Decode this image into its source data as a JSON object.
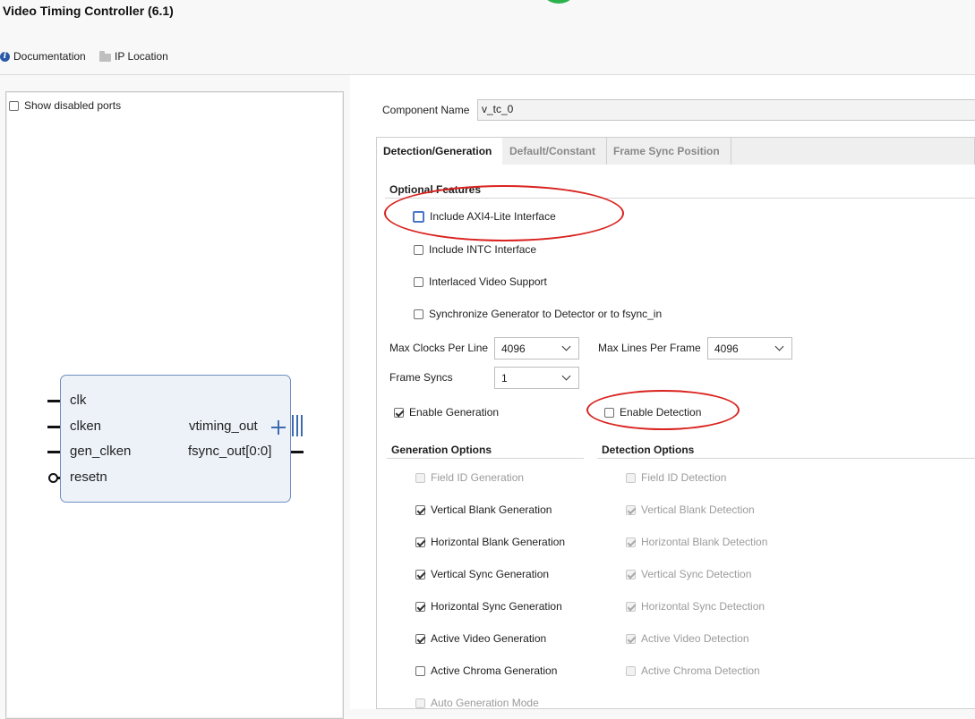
{
  "window": {
    "title": "Video Timing Controller (6.1)"
  },
  "toolbar": {
    "documentation": "Documentation",
    "ip_location": "IP Location"
  },
  "left_panel": {
    "show_disabled_ports": "Show disabled ports",
    "show_disabled_ports_checked": false,
    "ports_left": [
      "clk",
      "clken",
      "gen_clken",
      "resetn"
    ],
    "ports_right": [
      "vtiming_out",
      "fsync_out[0:0]"
    ]
  },
  "component": {
    "label": "Component Name",
    "value": "v_tc_0"
  },
  "tabs": [
    {
      "label": "Detection/Generation",
      "active": true
    },
    {
      "label": "Default/Constant",
      "active": false
    },
    {
      "label": "Frame Sync Position",
      "active": false
    }
  ],
  "optional_features": {
    "title": "Optional Features",
    "items": [
      {
        "label": "Include AXI4-Lite Interface",
        "checked": false
      },
      {
        "label": "Include INTC Interface",
        "checked": false
      },
      {
        "label": "Interlaced Video Support",
        "checked": false
      },
      {
        "label": "Synchronize Generator to Detector or to fsync_in",
        "checked": false
      }
    ]
  },
  "params": {
    "max_clocks_label": "Max Clocks Per Line",
    "max_clocks_value": "4096",
    "max_lines_label": "Max Lines Per Frame",
    "max_lines_value": "4096",
    "frame_syncs_label": "Frame Syncs",
    "frame_syncs_value": "1"
  },
  "enable": {
    "generation_label": "Enable Generation",
    "generation_checked": true,
    "detection_label": "Enable Detection",
    "detection_checked": false
  },
  "generation_options": {
    "title": "Generation Options",
    "items": [
      {
        "label": "Field ID Generation",
        "checked": false,
        "disabled": true
      },
      {
        "label": "Vertical Blank Generation",
        "checked": true,
        "disabled": false
      },
      {
        "label": "Horizontal Blank Generation",
        "checked": true,
        "disabled": false
      },
      {
        "label": "Vertical Sync Generation",
        "checked": true,
        "disabled": false
      },
      {
        "label": "Horizontal Sync Generation",
        "checked": true,
        "disabled": false
      },
      {
        "label": "Active Video Generation",
        "checked": true,
        "disabled": false
      },
      {
        "label": "Active Chroma Generation",
        "checked": false,
        "disabled": false
      },
      {
        "label": "Auto Generation Mode",
        "checked": false,
        "disabled": true
      }
    ]
  },
  "detection_options": {
    "title": "Detection Options",
    "items": [
      {
        "label": "Field ID Detection",
        "checked": false,
        "disabled": true
      },
      {
        "label": "Vertical Blank Detection",
        "checked": true,
        "disabled": true
      },
      {
        "label": "Horizontal Blank Detection",
        "checked": true,
        "disabled": true
      },
      {
        "label": "Vertical Sync Detection",
        "checked": true,
        "disabled": true
      },
      {
        "label": "Horizontal Sync Detection",
        "checked": true,
        "disabled": true
      },
      {
        "label": "Active Video Detection",
        "checked": true,
        "disabled": true
      },
      {
        "label": "Active Chroma Detection",
        "checked": false,
        "disabled": true
      }
    ]
  },
  "colors": {
    "annotation_red": "#d9231f",
    "block_fill": "#edf2f9",
    "block_border": "#6f8fbf"
  }
}
